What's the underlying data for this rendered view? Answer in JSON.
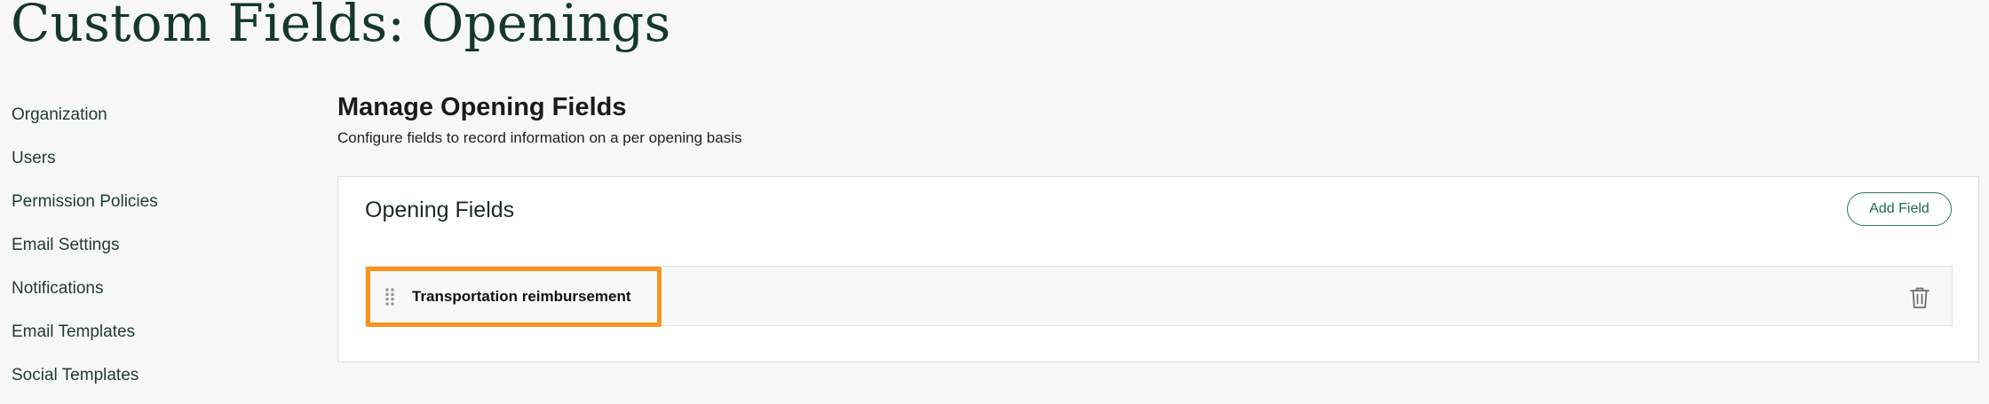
{
  "page": {
    "title": "Custom Fields: Openings"
  },
  "sidebar": {
    "items": [
      {
        "label": "Organization"
      },
      {
        "label": "Users"
      },
      {
        "label": "Permission Policies"
      },
      {
        "label": "Email Settings"
      },
      {
        "label": "Notifications"
      },
      {
        "label": "Email Templates"
      },
      {
        "label": "Social Templates"
      }
    ]
  },
  "main": {
    "heading": "Manage Opening Fields",
    "subheading": "Configure fields to record information on a per opening basis",
    "card": {
      "title": "Opening Fields",
      "add_button_label": "Add Field",
      "fields": [
        {
          "label": "Transportation reimbursement",
          "drag_icon": "drag-handle-icon",
          "delete_icon": "trash-icon"
        }
      ]
    }
  },
  "colors": {
    "title": "#15372c",
    "accent": "#2a7a56",
    "highlight": "#f7941d"
  }
}
